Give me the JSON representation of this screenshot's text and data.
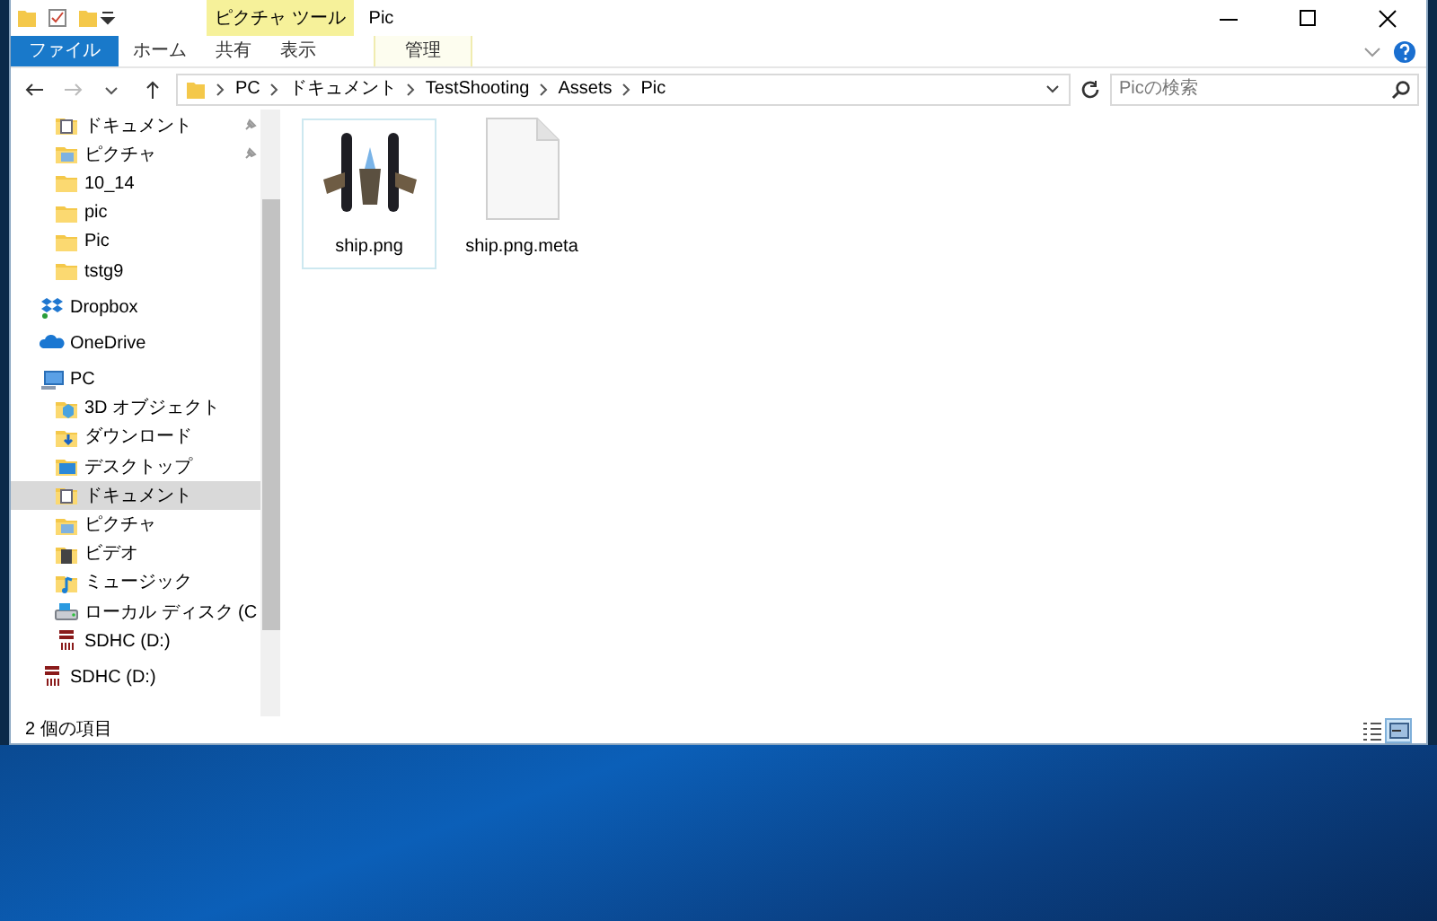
{
  "window": {
    "title": "Pic",
    "contextual_group": "ピクチャ ツール"
  },
  "ribbon_tabs": [
    {
      "label": "ファイル",
      "kind": "file"
    },
    {
      "label": "ホーム",
      "kind": "normal"
    },
    {
      "label": "共有",
      "kind": "normal"
    },
    {
      "label": "表示",
      "kind": "normal"
    },
    {
      "label": "管理",
      "kind": "contextual"
    }
  ],
  "address": {
    "path": [
      "PC",
      "ドキュメント",
      "TestShooting",
      "Assets",
      "Pic"
    ],
    "search_placeholder": "Picの検索"
  },
  "quick_access": [
    {
      "label": "ドキュメント",
      "kind": "doc-folder",
      "pinned": true,
      "selected": false
    },
    {
      "label": "ピクチャ",
      "kind": "pic-folder",
      "pinned": true,
      "selected": false
    },
    {
      "label": "10_14",
      "kind": "folder",
      "pinned": false,
      "selected": false
    },
    {
      "label": "pic",
      "kind": "folder",
      "pinned": false,
      "selected": false
    },
    {
      "label": "Pic",
      "kind": "folder",
      "pinned": false,
      "selected": false
    },
    {
      "label": "tstg9",
      "kind": "folder",
      "pinned": false,
      "selected": false
    }
  ],
  "nav": [
    {
      "label": "Dropbox",
      "kind": "dropbox",
      "selected": false
    },
    {
      "label": "OneDrive",
      "kind": "cloud",
      "selected": false
    },
    {
      "label": "PC",
      "kind": "pc",
      "selected": false,
      "children": [
        {
          "label": "3D オブジェクト",
          "kind": "cube-folder",
          "selected": false
        },
        {
          "label": "ダウンロード",
          "kind": "download-folder",
          "selected": false
        },
        {
          "label": "デスクトップ",
          "kind": "desktop-folder",
          "selected": false
        },
        {
          "label": "ドキュメント",
          "kind": "doc-folder",
          "selected": true
        },
        {
          "label": "ピクチャ",
          "kind": "pic-folder",
          "selected": false
        },
        {
          "label": "ビデオ",
          "kind": "video-folder",
          "selected": false
        },
        {
          "label": "ミュージック",
          "kind": "music-folder",
          "selected": false
        },
        {
          "label": "ローカル ディスク (C",
          "kind": "disk",
          "selected": false
        },
        {
          "label": "SDHC (D:)",
          "kind": "sd",
          "selected": false
        }
      ]
    },
    {
      "label": "SDHC (D:)",
      "kind": "sd",
      "selected": false
    }
  ],
  "files": [
    {
      "name": "ship.png",
      "kind": "image",
      "selected": true
    },
    {
      "name": "ship.png.meta",
      "kind": "document",
      "selected": false
    }
  ],
  "status_bar": {
    "text": "2 個の項目",
    "views": [
      {
        "kind": "details",
        "selected": false
      },
      {
        "kind": "large-icons",
        "selected": true
      }
    ]
  }
}
